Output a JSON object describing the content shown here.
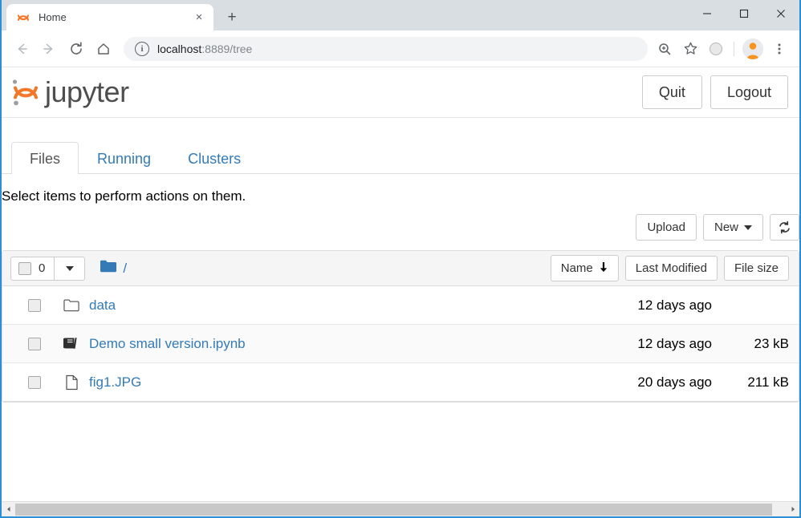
{
  "browser": {
    "tab": {
      "title": "Home",
      "favicon": "jupyter-favicon",
      "close_label": "×"
    },
    "new_tab_label": "+",
    "window_controls": {
      "minimize": "minimize-icon",
      "maximize": "maximize-icon",
      "close": "close-icon"
    },
    "nav": {
      "back": "back-arrow-icon",
      "forward": "forward-arrow-icon",
      "reload": "reload-icon",
      "home": "home-icon"
    },
    "omnibox": {
      "info_icon": "info-icon",
      "url_host": "localhost",
      "url_rest": ":8889/tree",
      "full_url": "localhost:8889/tree"
    },
    "omnibox_icons": [
      "zoom-icon",
      "bookmark-star-icon",
      "extension-icon",
      "profile-avatar-icon",
      "more-menu-icon"
    ]
  },
  "jupyter": {
    "logo_text": "jupyter",
    "logo_colors": {
      "arc": "#f37726",
      "dot": "#9e9e9e",
      "text": "#4e4e4e"
    },
    "header_buttons": [
      {
        "label": "Quit",
        "name": "quit-button"
      },
      {
        "label": "Logout",
        "name": "logout-button"
      }
    ],
    "tabs": [
      {
        "label": "Files",
        "active": true
      },
      {
        "label": "Running",
        "active": false
      },
      {
        "label": "Clusters",
        "active": false
      }
    ],
    "select_message": "Select items to perform actions on them.",
    "actions": {
      "upload_label": "Upload",
      "new_label": "New",
      "refresh_icon": "refresh-icon"
    },
    "list_toolbar": {
      "selected_count": "0",
      "dropdown_icon": "caret-down-icon",
      "folder_icon": "folder-icon",
      "breadcrumb_root": "/",
      "sort_buttons": [
        {
          "label": "Name",
          "indicator": "↓",
          "name": "sort-by-name"
        },
        {
          "label": "Last Modified",
          "indicator": "",
          "name": "sort-by-last-modified"
        },
        {
          "label": "File size",
          "indicator": "",
          "name": "sort-by-file-size"
        }
      ]
    },
    "files": [
      {
        "name": "data",
        "type": "folder",
        "icon": "folder-outline-icon",
        "modified": "12 days ago",
        "size": ""
      },
      {
        "name": "Demo small version.ipynb",
        "type": "notebook",
        "icon": "notebook-icon",
        "modified": "12 days ago",
        "size": "23 kB"
      },
      {
        "name": "fig1.JPG",
        "type": "file",
        "icon": "file-icon",
        "modified": "20 days ago",
        "size": "211 kB"
      }
    ]
  },
  "colors": {
    "link": "#337ab7",
    "jupyter_orange": "#f37726",
    "window_border": "#2a8fd4",
    "titlebar": "#d9dee3"
  }
}
